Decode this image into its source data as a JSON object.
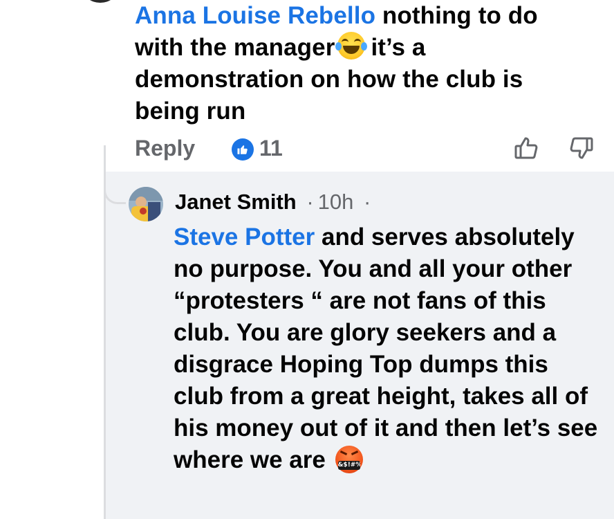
{
  "comment1": {
    "mention": "Anna Louise Rebello",
    "text_before_emoji": "nothing to do with the manager",
    "emoji": "face-with-tears-of-joy-emoji",
    "text_after_emoji": "it’s a demonstration on how the club is being run",
    "reply_label": "Reply",
    "like_count": "11",
    "like_icon": "like-thumbs-up-icon",
    "thumb_up_icon": "thumbs-up-outline-icon",
    "thumb_down_icon": "thumbs-down-outline-icon"
  },
  "comment2": {
    "author": "Janet Smith",
    "separator": "·",
    "time": "10h",
    "trailing_separator": "·",
    "mention": "Steve Potter",
    "text": "and serves absolutely no purpose. You and all your other “protesters “ are not fans of this club. You are glory seekers and a disgrace Hoping Top dumps this club from a great height, takes all of his money out of it and then let’s see where we are",
    "emoji": "face-with-symbols-on-mouth-emoji",
    "emoji_text": "&$!#%"
  },
  "colors": {
    "link": "#1b74e4",
    "text": "#050505",
    "muted": "#65676b",
    "reply_bg": "#f0f2f5"
  }
}
